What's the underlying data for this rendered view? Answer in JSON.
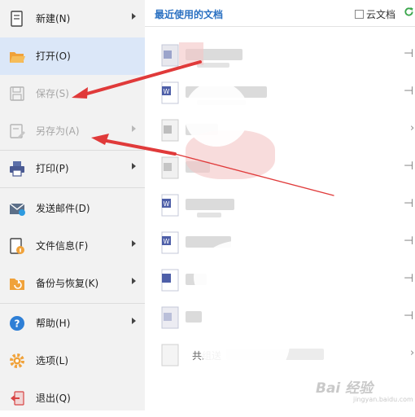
{
  "menu": {
    "items": [
      {
        "label": "新建(N)",
        "icon": "new-document-icon",
        "submenu": true,
        "state": "normal"
      },
      {
        "label": "打开(O)",
        "icon": "folder-open-icon",
        "submenu": false,
        "state": "active"
      },
      {
        "label": "保存(S)",
        "icon": "save-disk-icon",
        "submenu": false,
        "state": "disabled"
      },
      {
        "label": "另存为(A)",
        "icon": "save-as-icon",
        "submenu": true,
        "state": "disabled"
      },
      {
        "label": "打印(P)",
        "icon": "printer-icon",
        "submenu": true,
        "state": "normal"
      },
      {
        "label": "发送邮件(D)",
        "icon": "envelope-icon",
        "submenu": false,
        "state": "normal"
      },
      {
        "label": "文件信息(F)",
        "icon": "file-info-icon",
        "submenu": true,
        "state": "normal"
      },
      {
        "label": "备份与恢复(K)",
        "icon": "backup-restore-icon",
        "submenu": true,
        "state": "normal"
      },
      {
        "label": "帮助(H)",
        "icon": "help-icon",
        "submenu": true,
        "state": "normal"
      },
      {
        "label": "选项(L)",
        "icon": "gear-icon",
        "submenu": false,
        "state": "normal"
      },
      {
        "label": "退出(Q)",
        "icon": "exit-icon",
        "submenu": false,
        "state": "normal"
      }
    ]
  },
  "recent": {
    "title": "最近使用的文档",
    "cloud_label": "云文档",
    "partial_name": "共组送",
    "rows": 9
  },
  "watermark": {
    "text": "Bai 经验",
    "sub": "jingyan.baidu.com"
  },
  "colors": {
    "accent": "#2b71c2",
    "menu_bg": "#f2f2f2",
    "active_bg": "#dbe7f8",
    "arrow_red": "#e03a3a"
  }
}
